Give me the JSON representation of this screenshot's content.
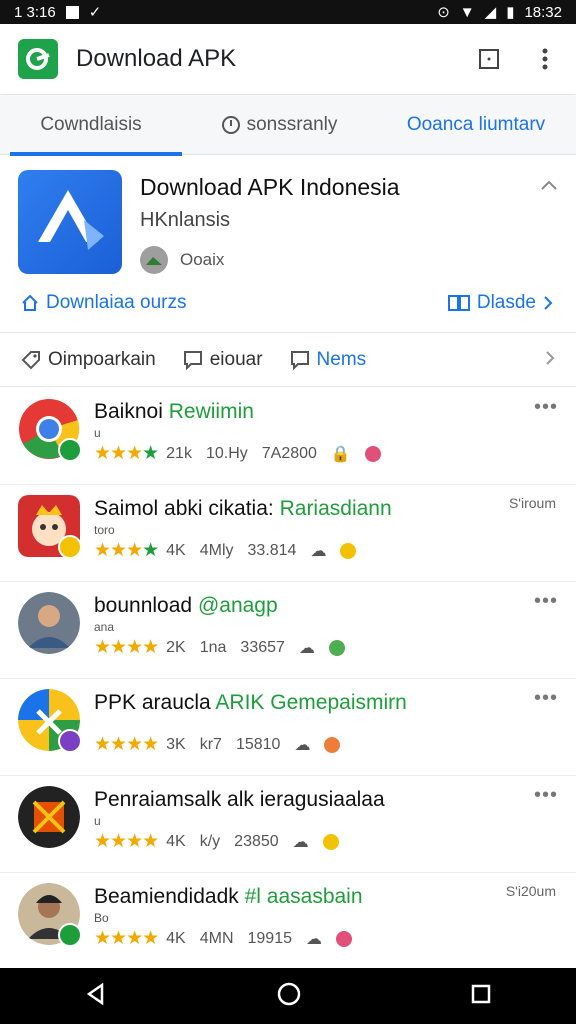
{
  "status_bar": {
    "time_left": "1 3:16",
    "time_right": "18:32"
  },
  "app_bar": {
    "title": "Download APK"
  },
  "tabs": [
    {
      "label": "Cowndlaisis",
      "active": true
    },
    {
      "label": "sonssranly",
      "active": false
    },
    {
      "label": "Ooanca liumtarv",
      "active": false
    }
  ],
  "featured": {
    "title": "Download APK Indonesia",
    "subtitle": "HKnlansis",
    "developer": "Ooaix",
    "link_left": "Downlaiaa ourzs",
    "link_right": "Dlasde"
  },
  "filters": [
    {
      "label": "Oimpoarkain",
      "icon": "tag-icon"
    },
    {
      "label": "eiouar",
      "icon": "message-icon"
    },
    {
      "label": "Nems",
      "icon": "message-icon"
    }
  ],
  "apps": [
    {
      "title": "Baiknoi",
      "highlight": "Rewiimin",
      "tag": "u",
      "rating": "21k",
      "installs": "10.Hy",
      "size": "7A2800",
      "right": "more",
      "right_text": "•••",
      "badge_color": "#1e9e3a",
      "icon": "chrome-icon"
    },
    {
      "title": "Saimol abki cikatia:",
      "highlight": "Rariasdiann",
      "tag": "toro",
      "rating": "4K",
      "installs": "4Mly",
      "size": "33.814",
      "right": "size",
      "right_text": "S'iroum",
      "badge_color": "#f2c200",
      "icon": "cartoon-icon"
    },
    {
      "title": "bounnload",
      "highlight": "@anagp",
      "tag": "ana",
      "rating": "2K",
      "installs": "1na",
      "size": "33657",
      "right": "more",
      "right_text": "•••",
      "badge_color": "",
      "icon": "person-icon"
    },
    {
      "title": "PPK araucla",
      "highlight": "ARIK Gemepaismirn",
      "tag": "",
      "rating": "3K",
      "installs": "kr7",
      "size": "15810",
      "right": "more",
      "right_text": "•••",
      "badge_color": "#7b3fc4",
      "icon": "maps-icon"
    },
    {
      "title": "Penraiamsalk alk ieragusiaalaa",
      "highlight": "",
      "tag": "u",
      "rating": "4K",
      "installs": "k/y",
      "size": "23850",
      "right": "more",
      "right_text": "•••",
      "badge_color": "",
      "icon": "game-icon"
    },
    {
      "title": "Beamiendidadk",
      "highlight": "#l aasasbain",
      "tag": "Bo",
      "rating": "4K",
      "installs": "4MN",
      "size": "19915",
      "right": "size",
      "right_text": "S'i20um",
      "badge_color": "#1e9e3a",
      "icon": "person-icon"
    }
  ]
}
